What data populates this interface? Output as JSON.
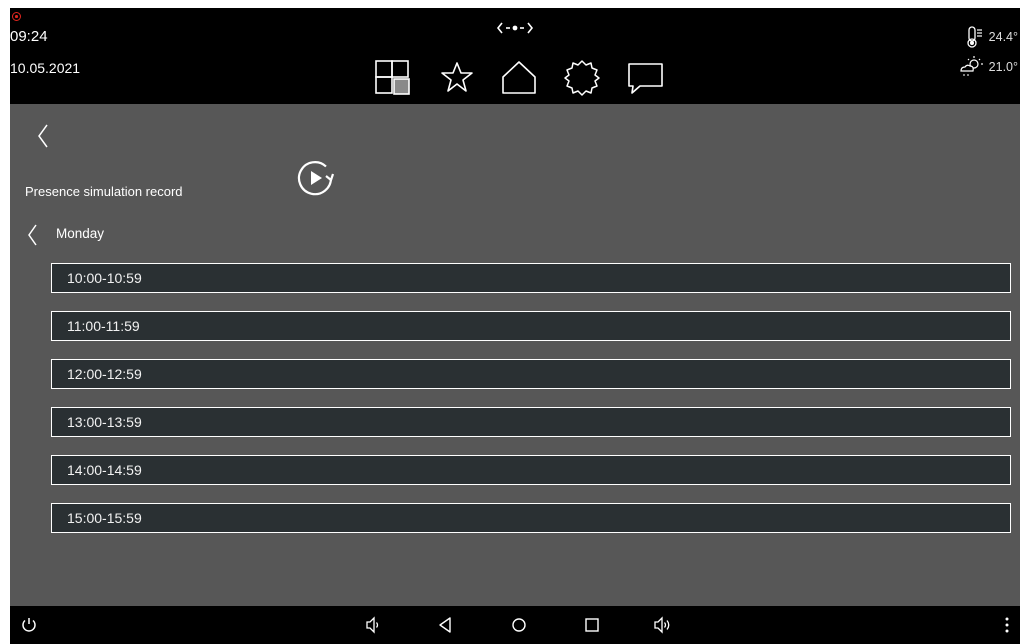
{
  "status": {
    "time": "09:24",
    "date": "10.05.2021",
    "indoor_temp": "24.4°",
    "outdoor_temp": "21.0°"
  },
  "icons": {
    "recording": "record-icon",
    "connection": "connection-icon",
    "nav": [
      "grid-icon",
      "star-icon",
      "home-icon",
      "settings-gear-icon",
      "message-icon"
    ],
    "thermometer": "thermometer-icon",
    "weather": "partly-sunny-icon",
    "play": "replay-play-icon",
    "system": [
      "power-icon",
      "volume-down-icon",
      "android-back-icon",
      "android-home-icon",
      "android-recents-icon",
      "volume-up-icon",
      "more-vert-icon"
    ]
  },
  "page": {
    "title": "Presence simulation record",
    "day": "Monday"
  },
  "slots": [
    "10:00-10:59",
    "11:00-11:59",
    "12:00-12:59",
    "13:00-13:59",
    "14:00-14:59",
    "15:00-15:59"
  ],
  "colors": {
    "background": "#000000",
    "panel": "#575757",
    "slot": "#2a3033",
    "record_accent": "#e0261f"
  }
}
